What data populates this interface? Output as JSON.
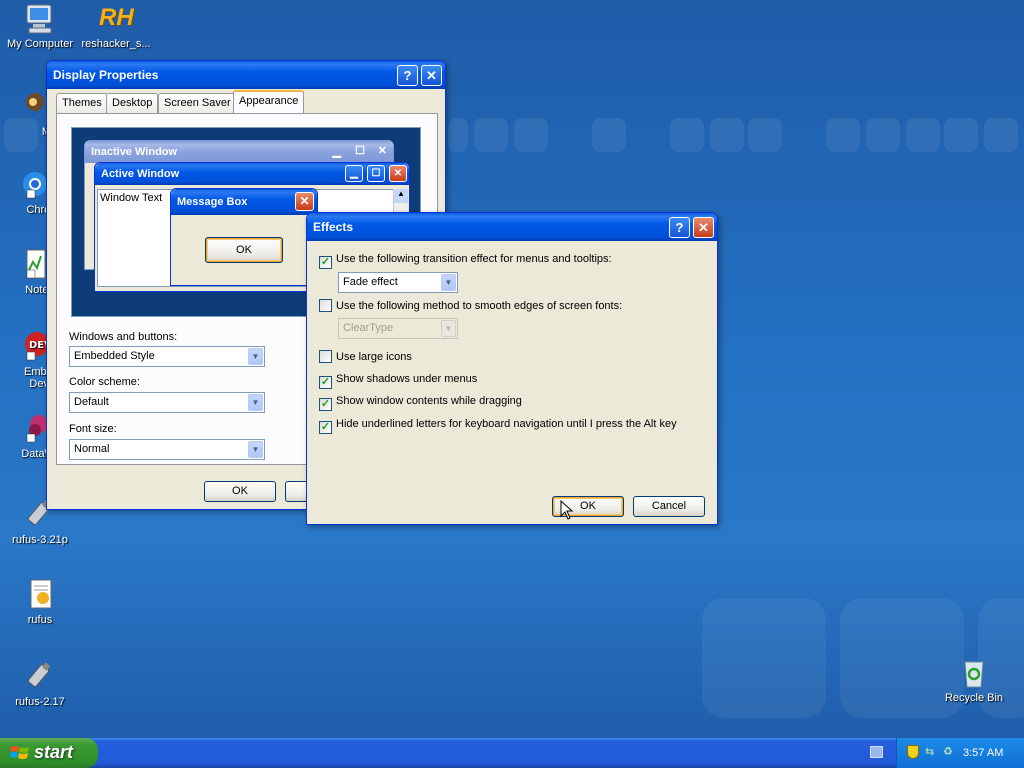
{
  "desktop": {
    "icons": [
      {
        "label": "My Computer"
      },
      {
        "label": "reshacker_s..."
      },
      {
        "label": "MyPa"
      },
      {
        "label": "Chrom"
      },
      {
        "label": "Notepa"
      },
      {
        "label": "Embarc"
      },
      {
        "label": "Dev-C"
      },
      {
        "label": "DataWa"
      },
      {
        "label": "rufus-3.21p"
      },
      {
        "label": "rufus"
      },
      {
        "label": "rufus-2.17"
      },
      {
        "label": "Recycle Bin"
      }
    ],
    "reshacker_glyph": "RH"
  },
  "display_properties": {
    "title": "Display Properties",
    "tabs": [
      "Themes",
      "Desktop",
      "Screen Saver",
      "Appearance"
    ],
    "active_tab": "Appearance",
    "preview": {
      "inactive_title": "Inactive Window",
      "active_title": "Active Window",
      "window_text": "Window Text",
      "message_box_title": "Message Box",
      "message_ok": "OK"
    },
    "windows_buttons_label": "Windows and buttons:",
    "windows_buttons_value": "Embedded Style",
    "color_scheme_label": "Color scheme:",
    "color_scheme_value": "Default",
    "font_size_label": "Font size:",
    "font_size_value": "Normal",
    "ok_label": "OK"
  },
  "effects": {
    "title": "Effects",
    "options": [
      {
        "label": "Use the following transition effect for menus and tooltips:",
        "checked": true
      },
      {
        "label": "Use the following method to smooth edges of screen fonts:",
        "checked": false
      },
      {
        "label": "Use large icons",
        "checked": false
      },
      {
        "label": "Show shadows under menus",
        "checked": true
      },
      {
        "label": "Show window contents while dragging",
        "checked": true
      },
      {
        "label": "Hide underlined letters for keyboard navigation until I press the Alt key",
        "checked": true
      }
    ],
    "transition_value": "Fade effect",
    "smoothing_value": "ClearType",
    "ok_label": "OK",
    "cancel_label": "Cancel"
  },
  "taskbar": {
    "start_label": "start",
    "clock": "3:57 AM"
  }
}
